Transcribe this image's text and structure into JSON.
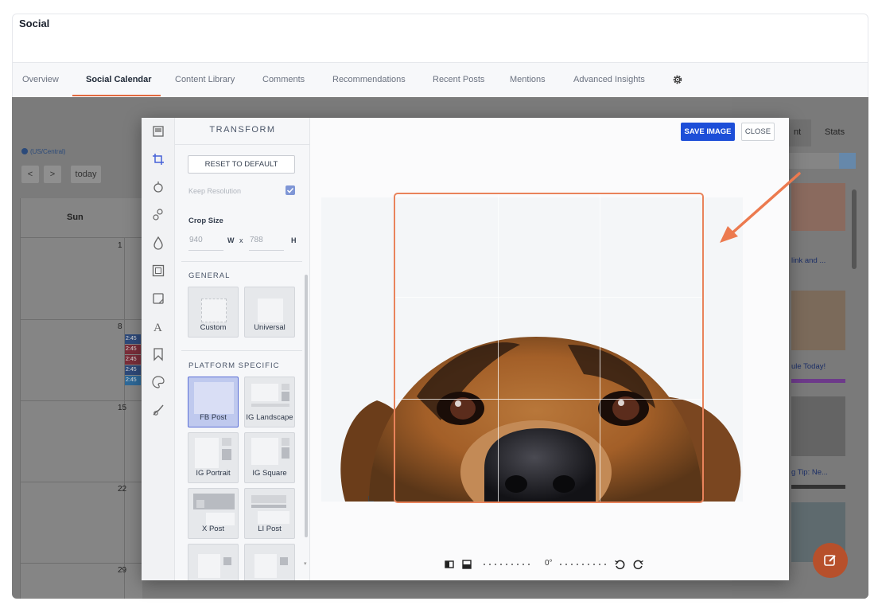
{
  "app": {
    "title": "Social"
  },
  "tabs": [
    {
      "label": "Overview"
    },
    {
      "label": "Social Calendar",
      "active": true
    },
    {
      "label": "Content Library"
    },
    {
      "label": "Comments"
    },
    {
      "label": "Recommendations"
    },
    {
      "label": "Recent Posts"
    },
    {
      "label": "Mentions"
    },
    {
      "label": "Advanced Insights"
    }
  ],
  "calendar": {
    "timezone": "(US/Central)",
    "prev_label": "<",
    "next_label": ">",
    "today_label": "today",
    "day_header": "Sun",
    "days": [
      "1",
      "8",
      "15",
      "22",
      "29"
    ],
    "events": [
      {
        "label": "2:45",
        "color": "#2e4a7a"
      },
      {
        "label": "2:45",
        "color": "#7a2e3a"
      },
      {
        "label": "2:45",
        "color": "#7a2e3a"
      },
      {
        "label": "2:45",
        "color": "#2e4a7a"
      },
      {
        "label": "2:45",
        "color": "#2e6a9a"
      }
    ]
  },
  "right_panel": {
    "tab_partial": "nt",
    "tab_stats": "Stats",
    "items": [
      {
        "text": "link and ..."
      },
      {
        "text": "ule Today!"
      },
      {
        "text": "g Tip: Ne..."
      }
    ]
  },
  "modal": {
    "panel_title": "TRANSFORM",
    "reset_label": "RESET TO DEFAULT",
    "keep_resolution_label": "Keep Resolution",
    "keep_resolution_checked": true,
    "crop_size_label": "Crop Size",
    "width_value": "940",
    "width_unit": "W",
    "times": "x",
    "height_value": "788",
    "height_unit": "H",
    "general_label": "GENERAL",
    "general_presets": [
      {
        "label": "Custom"
      },
      {
        "label": "Universal"
      }
    ],
    "platform_label": "PLATFORM SPECIFIC",
    "platform_presets": [
      {
        "label": "FB Post",
        "selected": true
      },
      {
        "label": "IG Landscape"
      },
      {
        "label": "IG Portrait"
      },
      {
        "label": "IG Square"
      },
      {
        "label": "X Post"
      },
      {
        "label": "LI Post"
      }
    ],
    "save_label": "SAVE IMAGE",
    "close_label": "CLOSE",
    "rotation": "0°",
    "accent_color": "#1d4ed8",
    "crop_color": "#e9835b"
  },
  "tools": [
    "frame-icon",
    "crop-icon",
    "filter-icon",
    "adjust-icon",
    "drop-icon",
    "border-icon",
    "sticker-icon",
    "text-icon",
    "bookmark-icon",
    "palette-icon",
    "brush-icon"
  ]
}
